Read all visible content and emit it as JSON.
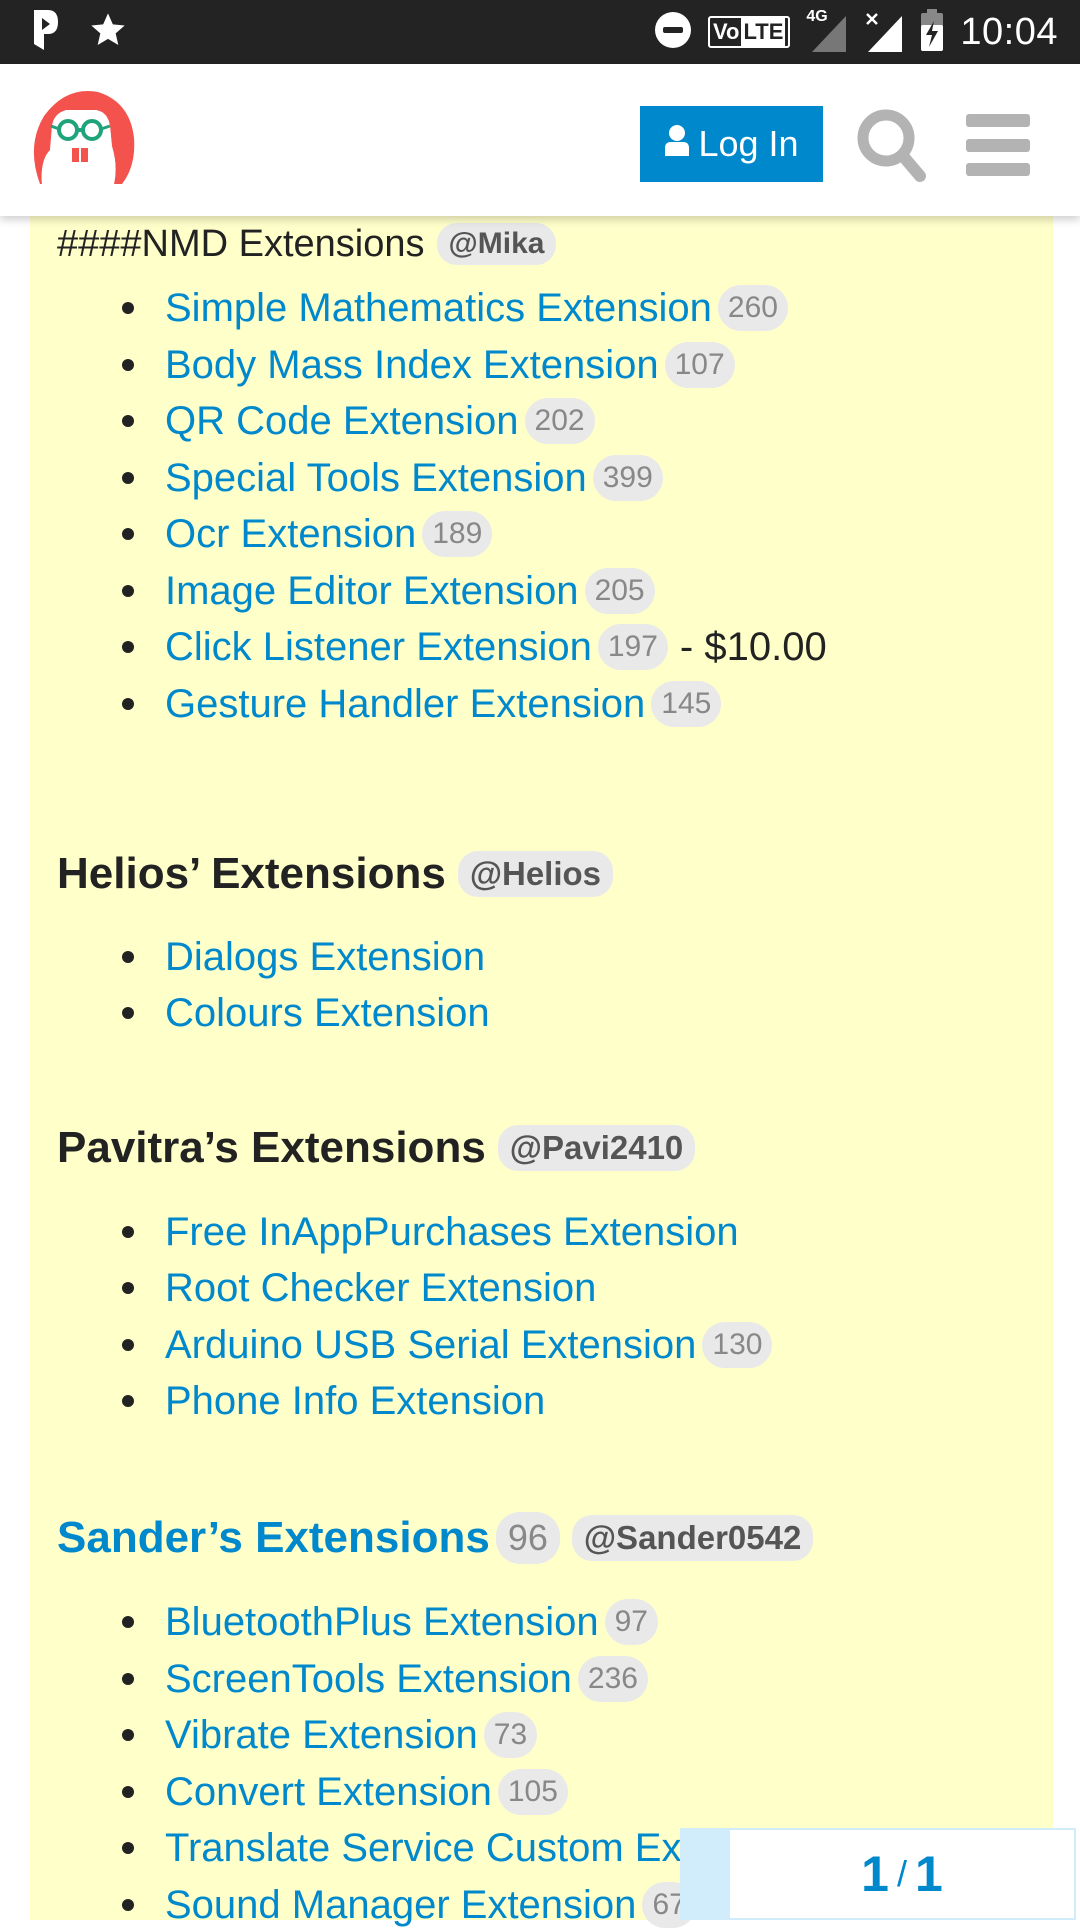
{
  "status_bar": {
    "left_icons": [
      "pocket-casts-icon",
      "star-icon"
    ],
    "right_icons": [
      "do-not-disturb-icon",
      "volte-icon",
      "signal-4g-icon",
      "signal-no-sim-icon",
      "battery-charging-icon"
    ],
    "volte_label_vo": "Vo",
    "volte_label_lte": "LTE",
    "network_label": "4G",
    "time": "10:04"
  },
  "header": {
    "logo": "app-inventor-community-logo",
    "login_label": "Log In",
    "search_icon": "search-icon",
    "menu_icon": "hamburger-menu-icon"
  },
  "colors": {
    "accent": "#0088cc",
    "panel_bg": "#ffffca",
    "badge_bg": "#e9e9e9",
    "logo_red": "#f4524d",
    "logo_green": "#1fa37a"
  },
  "sections": [
    {
      "title": "####NMD Extensions",
      "mention": "@Mika",
      "items": [
        {
          "label": "Simple Mathematics Extension",
          "count": "260"
        },
        {
          "label": "Body Mass Index Extension",
          "count": "107"
        },
        {
          "label": "QR Code Extension",
          "count": "202"
        },
        {
          "label": "Special Tools Extension",
          "count": "399"
        },
        {
          "label": "Ocr Extension",
          "count": "189"
        },
        {
          "label": "Image Editor Extension",
          "count": "205"
        },
        {
          "label": "Click Listener Extension",
          "count": "197",
          "price": "- $10.00"
        },
        {
          "label": "Gesture Handler Extension",
          "count": "145"
        }
      ]
    },
    {
      "title": "Helios’ Extensions",
      "mention": "@Helios",
      "items": [
        {
          "label": "Dialogs Extension"
        },
        {
          "label": "Colours Extension"
        }
      ]
    },
    {
      "title": "Pavitra’s Extensions",
      "mention": "@Pavi2410",
      "items": [
        {
          "label": "Free InAppPurchases Extension"
        },
        {
          "label": "Root Checker Extension"
        },
        {
          "label": "Arduino USB Serial Extension",
          "count": "130"
        },
        {
          "label": "Phone Info Extension"
        }
      ]
    },
    {
      "title": "Sander’s Extensions",
      "title_count": "96",
      "mention": "@Sander0542",
      "items": [
        {
          "label": "BluetoothPlus Extension",
          "count": "97"
        },
        {
          "label": "ScreenTools Extension",
          "count": "236"
        },
        {
          "label": "Vibrate Extension",
          "count": "73"
        },
        {
          "label": "Convert Extension",
          "count": "105"
        },
        {
          "label": "Translate Service Custom Extension"
        },
        {
          "label": "Sound Manager Extension",
          "count": "67"
        }
      ]
    }
  ],
  "timeline": {
    "current": "1",
    "separator": "/",
    "total": "1"
  }
}
